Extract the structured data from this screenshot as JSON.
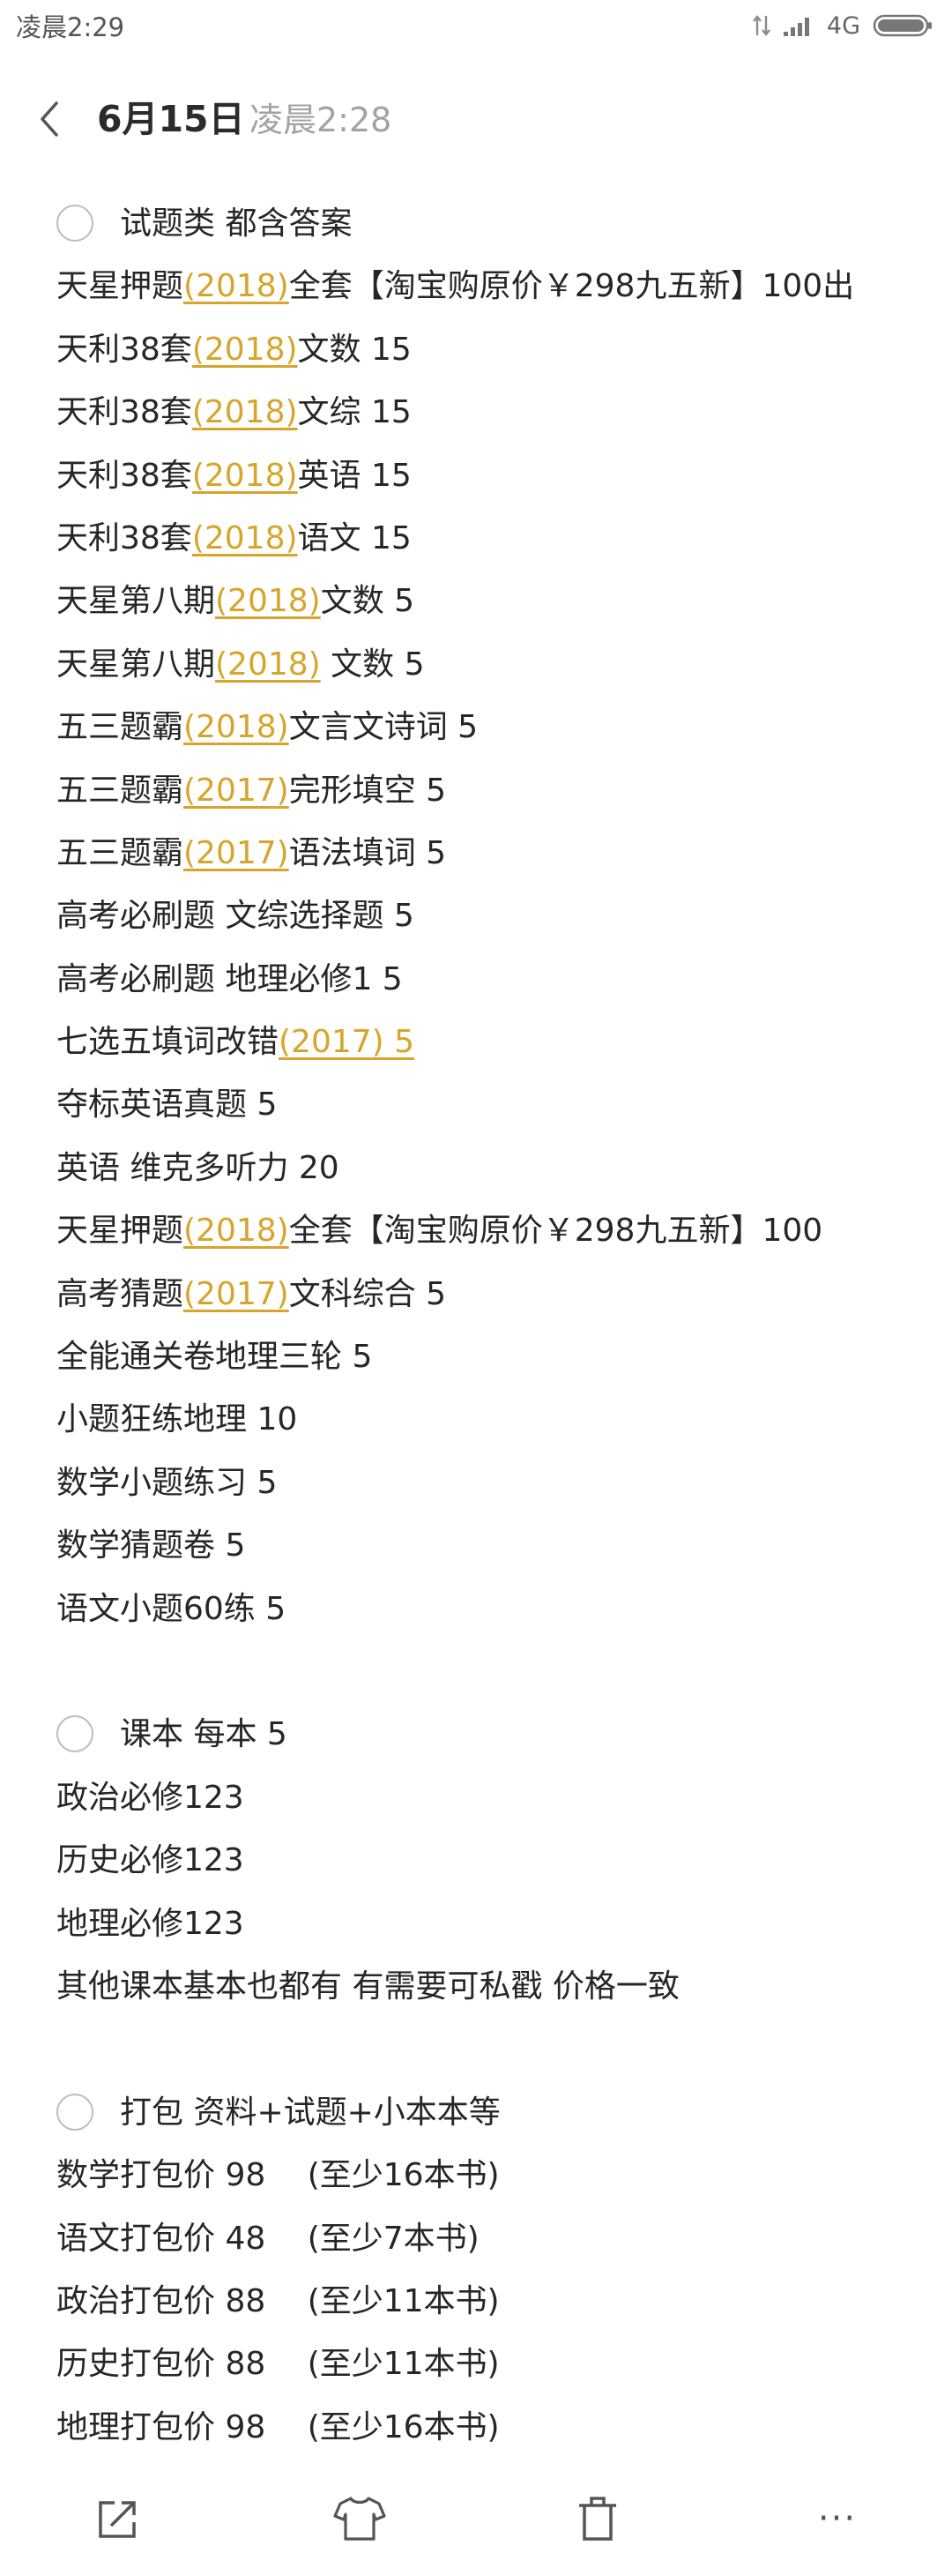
{
  "status_bar": {
    "time": "凌晨2:29",
    "network": "4G"
  },
  "header": {
    "title": "6月15日",
    "subtitle": "凌晨2:28"
  },
  "colors": {
    "accent": "#d7a52b",
    "text": "#262626",
    "muted": "#a2a2a2"
  },
  "lines": [
    {
      "checkbox": true,
      "parts": [
        {
          "t": "试题类 都含答案"
        }
      ]
    },
    {
      "parts": [
        {
          "t": "天星押题"
        },
        {
          "t": "(2018)",
          "y": true
        },
        {
          "t": "全套【淘宝购原价￥298九五新】100出"
        }
      ]
    },
    {
      "parts": [
        {
          "t": "天利38套"
        },
        {
          "t": "(2018)",
          "y": true
        },
        {
          "t": "文数 15"
        }
      ]
    },
    {
      "parts": [
        {
          "t": "天利38套"
        },
        {
          "t": "(2018)",
          "y": true
        },
        {
          "t": "文综 15"
        }
      ]
    },
    {
      "parts": [
        {
          "t": "天利38套"
        },
        {
          "t": "(2018)",
          "y": true
        },
        {
          "t": "英语 15"
        }
      ]
    },
    {
      "parts": [
        {
          "t": "天利38套"
        },
        {
          "t": "(2018)",
          "y": true
        },
        {
          "t": "语文 15"
        }
      ]
    },
    {
      "parts": [
        {
          "t": "天星第八期"
        },
        {
          "t": "(2018)",
          "y": true
        },
        {
          "t": "文数 5"
        }
      ]
    },
    {
      "parts": [
        {
          "t": "天星第八期"
        },
        {
          "t": "(2018)",
          "y": true
        },
        {
          "t": " 文数 5"
        }
      ]
    },
    {
      "parts": [
        {
          "t": "五三题霸"
        },
        {
          "t": "(2018)",
          "y": true
        },
        {
          "t": "文言文诗词 5"
        }
      ]
    },
    {
      "parts": [
        {
          "t": "五三题霸"
        },
        {
          "t": "(2017)",
          "y": true
        },
        {
          "t": "完形填空 5"
        }
      ]
    },
    {
      "parts": [
        {
          "t": "五三题霸"
        },
        {
          "t": "(2017)",
          "y": true
        },
        {
          "t": "语法填词 5"
        }
      ]
    },
    {
      "parts": [
        {
          "t": "高考必刷题 文综选择题 5"
        }
      ]
    },
    {
      "parts": [
        {
          "t": "高考必刷题 地理必修1 5"
        }
      ]
    },
    {
      "parts": [
        {
          "t": "七选五填词改错"
        },
        {
          "t": "(2017) 5",
          "y": true
        }
      ]
    },
    {
      "parts": [
        {
          "t": "夺标英语真题 5"
        }
      ]
    },
    {
      "parts": [
        {
          "t": "英语 维克多听力 20"
        }
      ]
    },
    {
      "parts": [
        {
          "t": "天星押题"
        },
        {
          "t": "(2018)",
          "y": true
        },
        {
          "t": "全套【淘宝购原价￥298九五新】100"
        }
      ]
    },
    {
      "parts": [
        {
          "t": "高考猜题"
        },
        {
          "t": "(2017)",
          "y": true
        },
        {
          "t": "文科综合 5"
        }
      ]
    },
    {
      "parts": [
        {
          "t": "全能通关卷地理三轮 5"
        }
      ]
    },
    {
      "parts": [
        {
          "t": "小题狂练地理 10"
        }
      ]
    },
    {
      "parts": [
        {
          "t": "数学小题练习 5"
        }
      ]
    },
    {
      "parts": [
        {
          "t": "数学猜题卷 5"
        }
      ]
    },
    {
      "parts": [
        {
          "t": "语文小题60练 5"
        }
      ]
    },
    {
      "blank": true
    },
    {
      "checkbox": true,
      "parts": [
        {
          "t": "课本 每本 5"
        }
      ]
    },
    {
      "parts": [
        {
          "t": "政治必修123"
        }
      ]
    },
    {
      "parts": [
        {
          "t": "历史必修123"
        }
      ]
    },
    {
      "parts": [
        {
          "t": "地理必修123"
        }
      ]
    },
    {
      "parts": [
        {
          "t": "其他课本基本也都有 有需要可私戳 价格一致"
        }
      ]
    },
    {
      "blank": true
    },
    {
      "checkbox": true,
      "parts": [
        {
          "t": "打包 资料+试题+小本本等"
        }
      ]
    },
    {
      "parts": [
        {
          "t": "数学打包价 98 　(至少16本书)"
        }
      ]
    },
    {
      "parts": [
        {
          "t": "语文打包价 48 　(至少7本书)"
        }
      ]
    },
    {
      "parts": [
        {
          "t": "政治打包价 88 　(至少11本书)"
        }
      ]
    },
    {
      "parts": [
        {
          "t": "历史打包价 88 　(至少11本书)"
        }
      ]
    },
    {
      "parts": [
        {
          "t": "地理打包价 98 　(至少16本书)"
        }
      ]
    }
  ],
  "toolbar": [
    {
      "name": "share-icon"
    },
    {
      "name": "theme-shirt-icon"
    },
    {
      "name": "delete-icon"
    },
    {
      "name": "more-icon",
      "label": "···"
    }
  ]
}
